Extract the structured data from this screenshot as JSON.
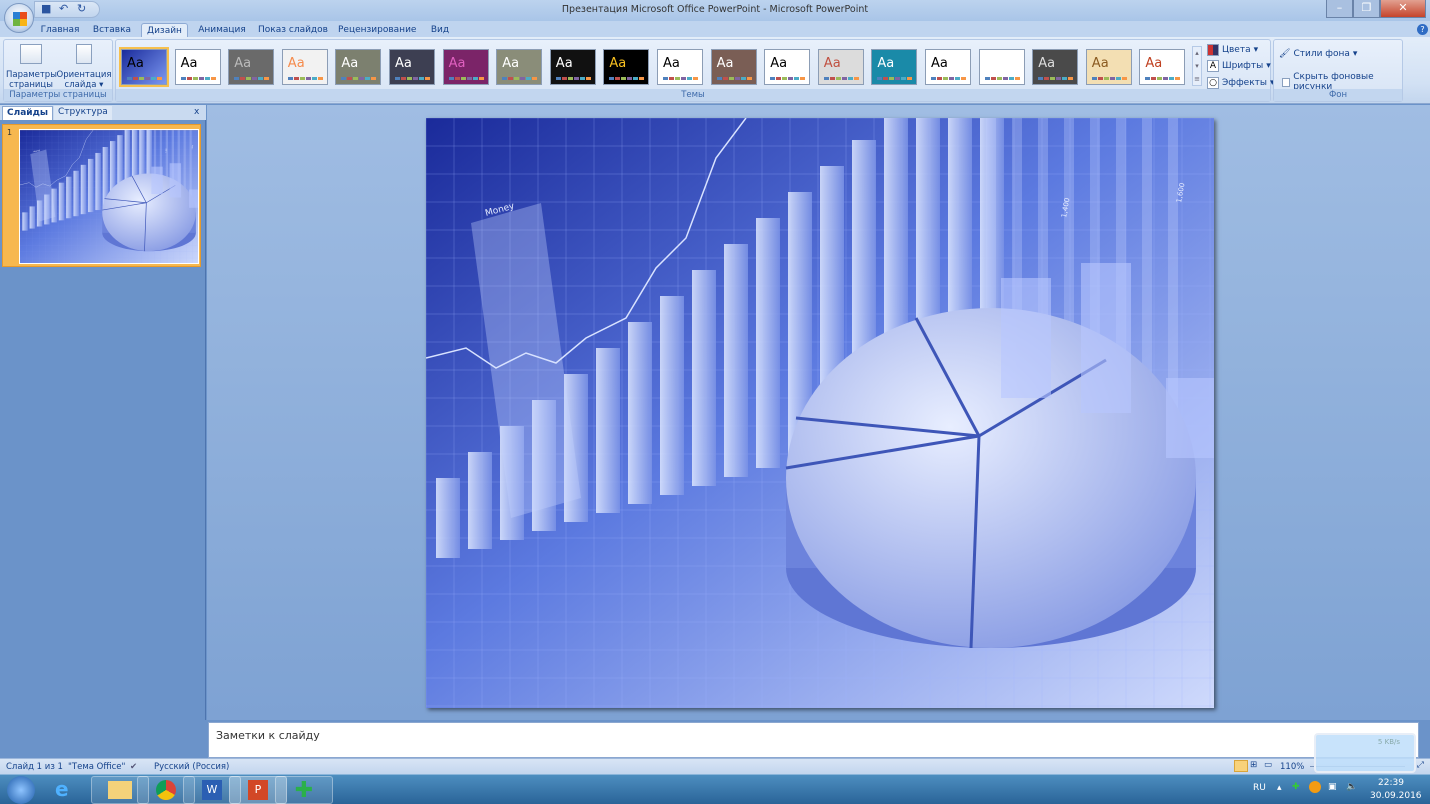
{
  "window": {
    "title": "Презентация Microsoft Office PowerPoint - Microsoft PowerPoint"
  },
  "tabs": [
    {
      "label": "Главная"
    },
    {
      "label": "Вставка"
    },
    {
      "label": "Дизайн",
      "active": true
    },
    {
      "label": "Анимация"
    },
    {
      "label": "Показ слайдов"
    },
    {
      "label": "Рецензирование"
    },
    {
      "label": "Вид"
    }
  ],
  "ribbon": {
    "page_setup": {
      "page_params": "Параметры страницы",
      "orientation": "Ориентация слайда",
      "group_label": "Параметры страницы"
    },
    "themes": {
      "group_label": "Темы",
      "thumb_text": "Aa",
      "backgrounds": [
        "#2a49b8",
        "#ffffff",
        "#6a6a6a",
        "#f2f2f2",
        "#7c806f",
        "#3d3f52",
        "#7b2468",
        "#8a8d79",
        "#111111",
        "#000000",
        "#ffffff",
        "#7a5e55",
        "#ffffff",
        "#dcdcdc",
        "#1a8aa8",
        "#ffffff",
        "#ffffff",
        "#4a4a4a",
        "#f3dfb3",
        "#ffffff"
      ],
      "text_colors": [
        "#000000",
        "#000000",
        "#bbbbbb",
        "#f58b4c",
        "#ffffff",
        "#ffffff",
        "#e060c0",
        "#ffffff",
        "#ffffff",
        "#f8c020",
        "#000000",
        "#ffffff",
        "#000000",
        "#c05040",
        "#ffffff",
        "#000000",
        "#ffffff",
        "#dddddd",
        "#8a5a20",
        "#c04020"
      ],
      "colors": "Цвета",
      "fonts": "Шрифты",
      "effects": "Эффекты"
    },
    "background": {
      "styles": "Стили фона",
      "hide_graphics": "Скрыть фоновые рисунки",
      "hide_graphics_checked": false,
      "group_label": "Фон"
    }
  },
  "left_pane": {
    "tab_slides": "Слайды",
    "tab_outline": "Структура",
    "close": "x",
    "slide_number": "1"
  },
  "slide": {
    "label_money": "Money",
    "label_a": "1,400",
    "label_b": "1,600"
  },
  "notes": {
    "placeholder": "Заметки к слайду"
  },
  "status": {
    "slide": "Слайд 1 из 1",
    "theme": "\"Тема Office\"",
    "language": "Русский (Россия)",
    "zoom": "110%"
  },
  "tray": {
    "lang": "RU",
    "time": "22:39",
    "date": "30.09.2016",
    "net_speed": "5 KB/s"
  }
}
